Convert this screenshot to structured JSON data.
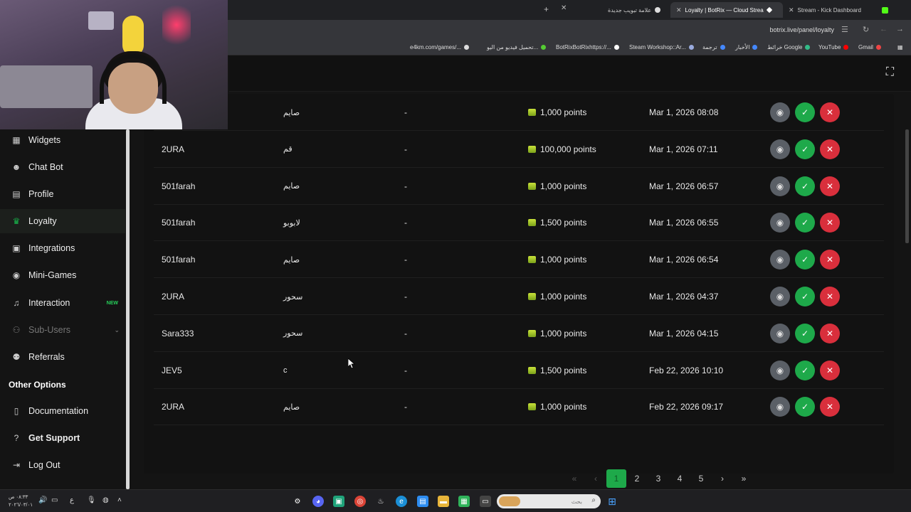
{
  "browser": {
    "tabs": [
      {
        "label": "علامة تبويب جديدة",
        "active": false
      },
      {
        "label": "Loyalty | BotRix — Cloud Strea",
        "active": true
      },
      {
        "label": "Stream - Kick Dashboard",
        "active": false
      }
    ],
    "url": "botrix.live/panel/loyalty",
    "bookmarks": [
      "Gmail",
      "YouTube",
      "خرائط Google",
      "الأخبار",
      "ترجمة",
      "Steam Workshop::Ar...",
      "BotRixBotRixhttps://...",
      "تحميل فيديو من اليو...",
      "e4km.com/games/..."
    ]
  },
  "sidebar": {
    "items": [
      {
        "label": "Widgets",
        "icon": "grid-icon"
      },
      {
        "label": "Chat Bot",
        "icon": "robot-icon"
      },
      {
        "label": "Profile",
        "icon": "profile-card-icon"
      },
      {
        "label": "Loyalty",
        "icon": "trophy-icon"
      },
      {
        "label": "Integrations",
        "icon": "puzzle-icon"
      },
      {
        "label": "Mini-Games",
        "icon": "gamepad-icon"
      },
      {
        "label": "Interaction",
        "icon": "music-note-icon",
        "badge": "NEW"
      },
      {
        "label": "Sub-Users",
        "icon": "users-icon"
      },
      {
        "label": "Referrals",
        "icon": "referral-icon"
      }
    ],
    "other_title": "Other Options",
    "other": [
      {
        "label": "Documentation",
        "icon": "book-icon"
      },
      {
        "label": "Get Support",
        "icon": "help-icon"
      },
      {
        "label": "Log Out",
        "icon": "logout-icon"
      }
    ]
  },
  "redemptions": [
    {
      "user": "",
      "reward": "صايم",
      "note": "-",
      "points": "1,000 points",
      "date": "Mar 1, 2026 08:08"
    },
    {
      "user": "2URA",
      "reward": "قم",
      "note": "-",
      "points": "100,000 points",
      "date": "Mar 1, 2026 07:11"
    },
    {
      "user": "501farah",
      "reward": "صايم",
      "note": "-",
      "points": "1,000 points",
      "date": "Mar 1, 2026 06:57"
    },
    {
      "user": "501farah",
      "reward": "لابوبو",
      "note": "-",
      "points": "1,500 points",
      "date": "Mar 1, 2026 06:55"
    },
    {
      "user": "501farah",
      "reward": "صايم",
      "note": "-",
      "points": "1,000 points",
      "date": "Mar 1, 2026 06:54"
    },
    {
      "user": "2URA",
      "reward": "سحور",
      "note": "-",
      "points": "1,000 points",
      "date": "Mar 1, 2026 04:37"
    },
    {
      "user": "Sara333",
      "reward": "سحور",
      "note": "-",
      "points": "1,000 points",
      "date": "Mar 1, 2026 04:15"
    },
    {
      "user": "JEV5",
      "reward": "c",
      "note": "-",
      "points": "1,500 points",
      "date": "Feb 22, 2026 10:10"
    },
    {
      "user": "2URA",
      "reward": "صايم",
      "note": "-",
      "points": "1,000 points",
      "date": "Feb 22, 2026 09:17"
    }
  ],
  "pagination": {
    "first": "«",
    "prev": "‹",
    "pages": [
      "1",
      "2",
      "3",
      "4",
      "5"
    ],
    "current": "1",
    "next": "›",
    "last": "»"
  },
  "taskbar": {
    "search_placeholder": "بحث",
    "time": "٠٨:٣٣ ص",
    "date": "٢٠٢٦/٠٣/٠١",
    "lang": "ع"
  },
  "colors": {
    "accent_green": "#1ea94a",
    "reject_red": "#d92f3c",
    "view_gray": "#5a5f66"
  }
}
